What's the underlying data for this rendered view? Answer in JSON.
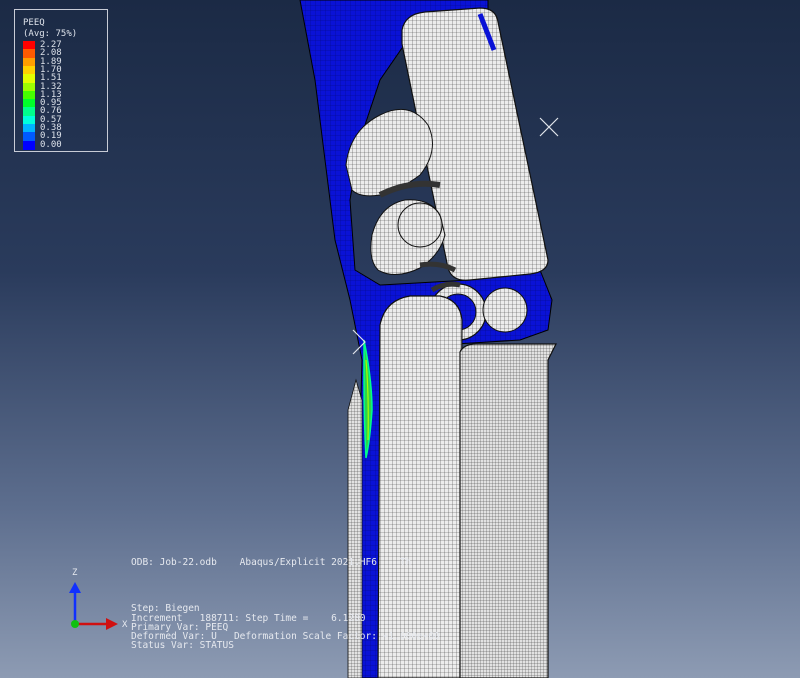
{
  "legend": {
    "title": "PEEQ",
    "subtitle": "(Avg: 75%)",
    "entries": [
      {
        "value": "+2.27e+00",
        "label": "2.27",
        "color": "#ff0000"
      },
      {
        "value": "+2.08e+00",
        "label": "2.08",
        "color": "#ff5a00"
      },
      {
        "value": "+1.89e+00",
        "label": "1.89",
        "color": "#ff9e00"
      },
      {
        "value": "+1.70e+00",
        "label": "1.70",
        "color": "#ffd200"
      },
      {
        "value": "+1.51e+00",
        "label": "1.51",
        "color": "#e4ff00"
      },
      {
        "value": "+1.32e+00",
        "label": "1.32",
        "color": "#9eff00"
      },
      {
        "value": "+1.13e+00",
        "label": "1.13",
        "color": "#46ff00"
      },
      {
        "value": "+0.95e+00",
        "label": "0.95",
        "color": "#00ff2a"
      },
      {
        "value": "+0.76e+00",
        "label": "0.76",
        "color": "#00ff8c"
      },
      {
        "value": "+0.57e+00",
        "label": "0.57",
        "color": "#00ffdc"
      },
      {
        "value": "+0.38e+00",
        "label": "0.38",
        "color": "#00b4ff"
      },
      {
        "value": "+0.19e+00",
        "label": "0.19",
        "color": "#005aff"
      },
      {
        "value": "+0.00e+00",
        "label": "0.00",
        "color": "#0000ff"
      }
    ]
  },
  "info": {
    "odb_line": "ODB: Job-22.odb    Abaqus/Explicit 2021.HF6    Th",
    "step": "Step: Biegen",
    "increment": "Increment   188711: Step Time =    6.1200",
    "primary_var": "Primary Var: PEEQ",
    "deformed_var": "Deformed Var: U   Deformation Scale Factor: +1.000e+00",
    "status_var": "Status Var: STATUS"
  },
  "triad": {
    "z_label": "Z",
    "x_label": "X",
    "z_color": "#1030ff",
    "x_color": "#d01010",
    "origin_color": "#10c010"
  },
  "colors": {
    "mesh_fill": "#e9e9e9",
    "mesh_line": "#303030",
    "blue_region": "#0a0fd8"
  }
}
